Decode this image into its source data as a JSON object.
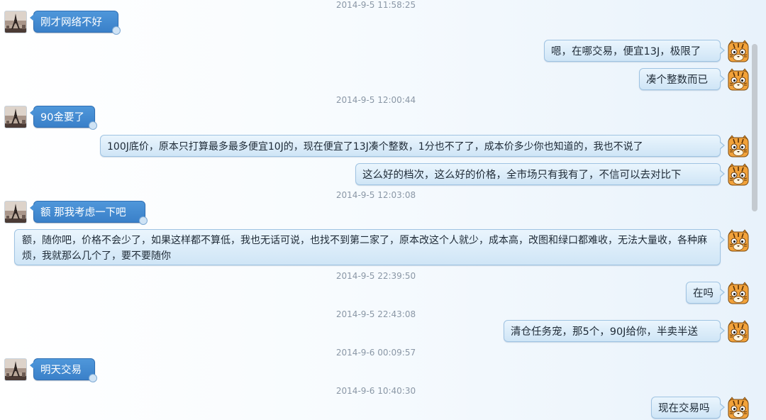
{
  "colors": {
    "incoming_bubble": "#3a80c9",
    "outgoing_bubble": "#d8ebf8",
    "timestamp": "#8a97a6",
    "background": "#eef5fc"
  },
  "avatars": {
    "contact": "eiffel-tower-photo-avatar",
    "self": "tiger-cartoon-avatar"
  },
  "timestamps": [
    "2014-9-5 11:58:25",
    "2014-9-5 12:00:44",
    "2014-9-5 12:03:08",
    "2014-9-5 22:39:50",
    "2014-9-5 22:43:08",
    "2014-9-6 00:09:57",
    "2014-9-6 10:40:30"
  ],
  "messages": [
    {
      "side": "left",
      "text": "刚才网络不好"
    },
    {
      "side": "right",
      "text": "嗯，在哪交易，便宜13J，极限了"
    },
    {
      "side": "right",
      "text": "凑个整数而已"
    },
    {
      "side": "left",
      "text": "90金要了"
    },
    {
      "side": "right",
      "text": "100J底价，原本只打算最多最多便宜10J的，现在便宜了13J凑个整数，1分也不了了，成本价多少你也知道的，我也不说了"
    },
    {
      "side": "right",
      "text": "这么好的档次，这么好的价格，全市场只有我有了，不信可以去对比下"
    },
    {
      "side": "left",
      "text": "额 那我考虑一下吧"
    },
    {
      "side": "right",
      "text": "额，随你吧，价格不会少了，如果这样都不算低，我也无话可说，也找不到第二家了，原本改这个人就少，成本高，改图和绿口都难收，无法大量收，各种麻烦，我就那么几个了，要不要随你"
    },
    {
      "side": "right",
      "text": "在吗"
    },
    {
      "side": "right",
      "text": "清仓任务宠，那5个，90J给你，半卖半送"
    },
    {
      "side": "left",
      "text": "明天交易"
    },
    {
      "side": "right",
      "text": "现在交易吗"
    }
  ]
}
